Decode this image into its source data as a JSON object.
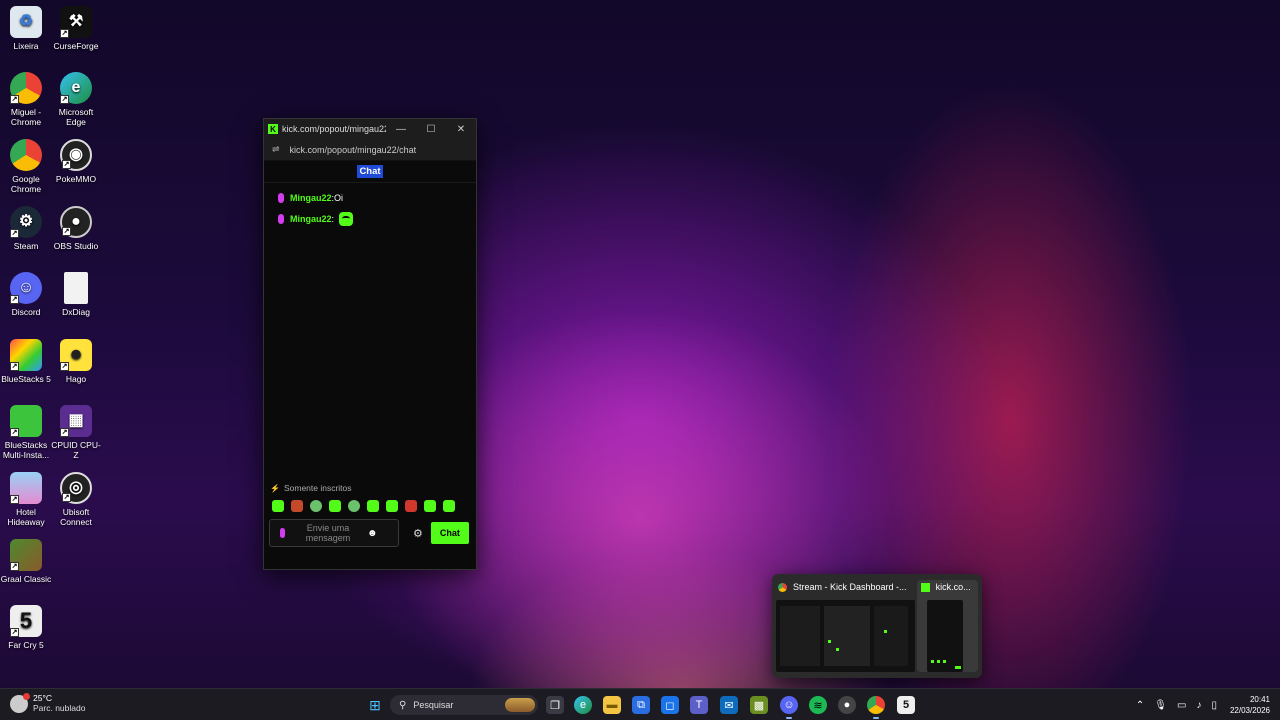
{
  "desktop": {
    "icons": [
      {
        "label": "Lixeira",
        "icon": "recycle-bin-icon"
      },
      {
        "label": "CurseForge",
        "icon": "curseforge-icon"
      },
      {
        "label": "Miguel - Chrome",
        "icon": "chrome-profile-icon"
      },
      {
        "label": "Microsoft Edge",
        "icon": "edge-icon"
      },
      {
        "label": "Google Chrome",
        "icon": "chrome-icon"
      },
      {
        "label": "PokeMMO",
        "icon": "pokemmo-icon"
      },
      {
        "label": "Steam",
        "icon": "steam-icon"
      },
      {
        "label": "OBS Studio",
        "icon": "obs-icon"
      },
      {
        "label": "Discord",
        "icon": "discord-icon"
      },
      {
        "label": "DxDiag",
        "icon": "dxdiag-icon"
      },
      {
        "label": "BlueStacks 5",
        "icon": "bluestacks-icon"
      },
      {
        "label": "Hago",
        "icon": "hago-icon"
      },
      {
        "label": "BlueStacks Multi-Insta...",
        "icon": "bluestacks-multi-icon"
      },
      {
        "label": "CPUID CPU-Z",
        "icon": "cpuz-icon"
      },
      {
        "label": "Hotel Hideaway",
        "icon": "hotel-hideaway-icon"
      },
      {
        "label": "Ubisoft Connect",
        "icon": "ubisoft-icon"
      },
      {
        "label": "Graal Classic",
        "icon": "graal-icon"
      },
      {
        "label": "Far Cry 5",
        "icon": "farcry5-icon"
      }
    ]
  },
  "popup": {
    "title": "kick.com/popout/mingau22...",
    "url": "kick.com/popout/mingau22/chat",
    "chat_tab": "Chat",
    "messages": [
      {
        "user": "Mingau22",
        "sep": ":",
        "text": " Oi",
        "emote": false
      },
      {
        "user": "Mingau22",
        "sep": ":",
        "text": "",
        "emote": true
      }
    ],
    "subscribers_only": "Somente inscritos",
    "input_placeholder": "Envie uma mensagem",
    "send_label": "Chat"
  },
  "taskbar_preview": {
    "items": [
      {
        "title": "Stream - Kick Dashboard -..."
      },
      {
        "title": "kick.co..."
      }
    ]
  },
  "taskbar": {
    "weather_temp": "25°C",
    "weather_condition": "Parc. nublado",
    "search_placeholder": "Pesquisar",
    "time": "20:41",
    "date": "22/03/2026"
  },
  "colors": {
    "kick_green": "#53fc18",
    "accent_purple": "#d43cf0",
    "highlight_blue": "#1f4bd8"
  }
}
